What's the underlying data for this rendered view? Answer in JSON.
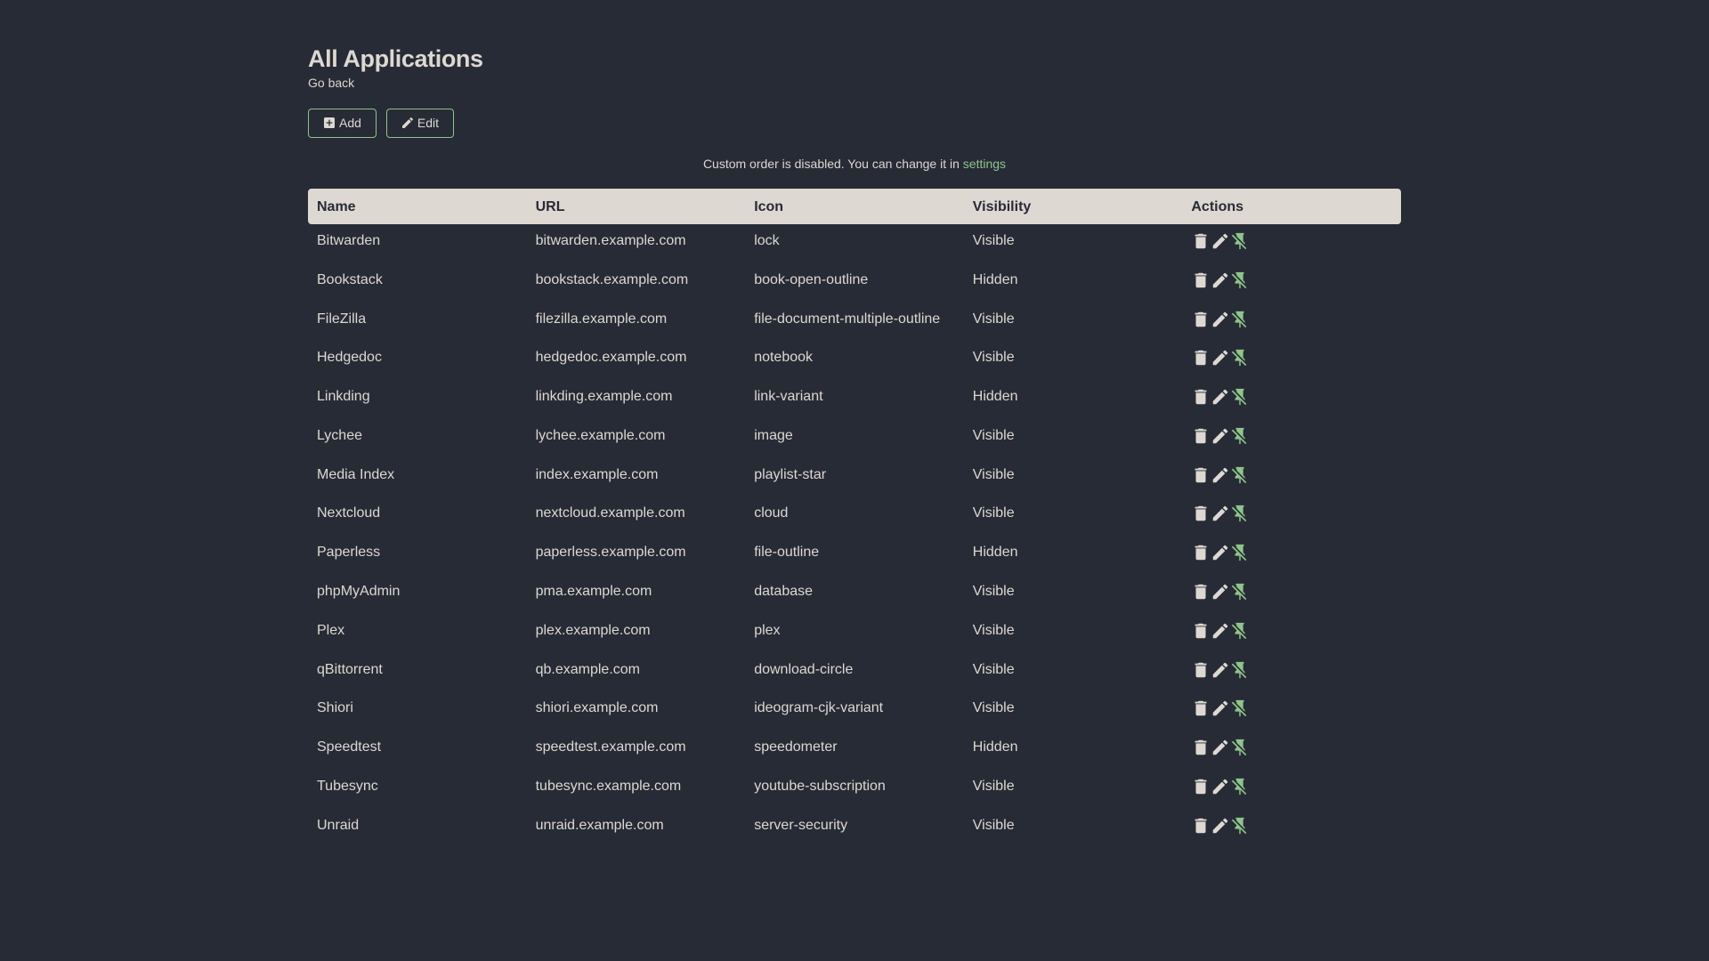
{
  "header": {
    "title": "All Applications",
    "go_back_label": "Go back"
  },
  "toolbar": {
    "add_label": "Add",
    "edit_label": "Edit"
  },
  "notice": {
    "text": "Custom order is disabled. You can change it in ",
    "link_label": "settings"
  },
  "table": {
    "columns": [
      "Name",
      "URL",
      "Icon",
      "Visibility",
      "Actions"
    ],
    "row_action_icons": [
      "delete-icon",
      "pencil-icon",
      "pin-off-icon"
    ],
    "rows": [
      {
        "name": "Bitwarden",
        "url": "bitwarden.example.com",
        "icon": "lock",
        "visibility": "Visible"
      },
      {
        "name": "Bookstack",
        "url": "bookstack.example.com",
        "icon": "book-open-outline",
        "visibility": "Hidden"
      },
      {
        "name": "FileZilla",
        "url": "filezilla.example.com",
        "icon": "file-document-multiple-outline",
        "visibility": "Visible"
      },
      {
        "name": "Hedgedoc",
        "url": "hedgedoc.example.com",
        "icon": "notebook",
        "visibility": "Visible"
      },
      {
        "name": "Linkding",
        "url": "linkding.example.com",
        "icon": "link-variant",
        "visibility": "Hidden"
      },
      {
        "name": "Lychee",
        "url": "lychee.example.com",
        "icon": "image",
        "visibility": "Visible"
      },
      {
        "name": "Media Index",
        "url": "index.example.com",
        "icon": "playlist-star",
        "visibility": "Visible"
      },
      {
        "name": "Nextcloud",
        "url": "nextcloud.example.com",
        "icon": "cloud",
        "visibility": "Visible"
      },
      {
        "name": "Paperless",
        "url": "paperless.example.com",
        "icon": "file-outline",
        "visibility": "Hidden"
      },
      {
        "name": "phpMyAdmin",
        "url": "pma.example.com",
        "icon": "database",
        "visibility": "Visible"
      },
      {
        "name": "Plex",
        "url": "plex.example.com",
        "icon": "plex",
        "visibility": "Visible"
      },
      {
        "name": "qBittorrent",
        "url": "qb.example.com",
        "icon": "download-circle",
        "visibility": "Visible"
      },
      {
        "name": "Shiori",
        "url": "shiori.example.com",
        "icon": "ideogram-cjk-variant",
        "visibility": "Visible"
      },
      {
        "name": "Speedtest",
        "url": "speedtest.example.com",
        "icon": "speedometer",
        "visibility": "Hidden"
      },
      {
        "name": "Tubesync",
        "url": "tubesync.example.com",
        "icon": "youtube-subscription",
        "visibility": "Visible"
      },
      {
        "name": "Unraid",
        "url": "unraid.example.com",
        "icon": "server-security",
        "visibility": "Visible"
      }
    ]
  },
  "colors": {
    "background": "#272b35",
    "primary": "#ddd8d2",
    "accent": "#8fc58c"
  }
}
